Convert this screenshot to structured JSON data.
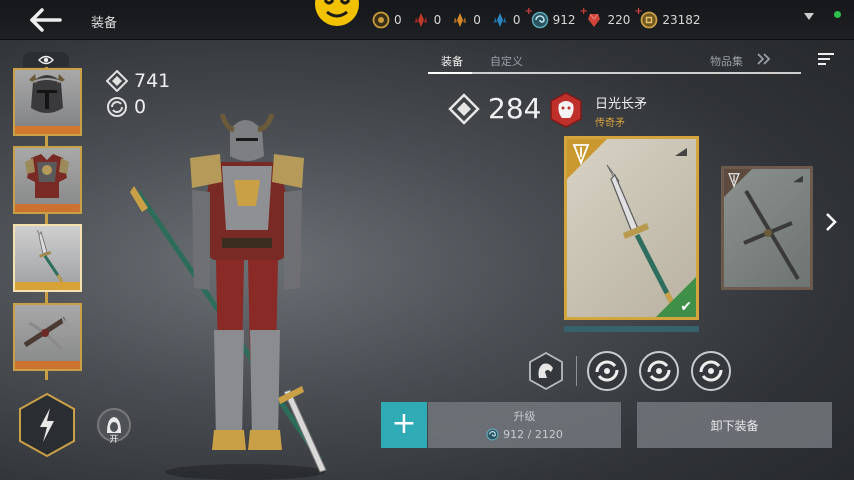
{
  "header": {
    "title": "装备"
  },
  "resources": [
    {
      "name": "gold-orb-icon",
      "value": "0",
      "color": "#c89c3c",
      "has_plus": false
    },
    {
      "name": "red-crystal-icon",
      "value": "0",
      "color": "#c0392b",
      "has_plus": false
    },
    {
      "name": "orange-crystal-icon",
      "value": "0",
      "color": "#d68a2c",
      "has_plus": false
    },
    {
      "name": "blue-crystal-icon",
      "value": "0",
      "color": "#2e86c1",
      "has_plus": false
    },
    {
      "name": "swirl-orb-icon",
      "value": "912",
      "color": "#5fa7b6",
      "has_plus": true
    },
    {
      "name": "ruby-icon",
      "value": "220",
      "color": "#d0453a",
      "has_plus": true
    },
    {
      "name": "coin-icon",
      "value": "23182",
      "color": "#c9a046",
      "has_plus": true
    }
  ],
  "character": {
    "power": "741",
    "secondary": "0",
    "toggle_label": "开"
  },
  "tabs": [
    {
      "label": "装备",
      "active": true
    },
    {
      "label": "自定义",
      "active": false
    },
    {
      "label": "物品集",
      "active": false
    }
  ],
  "item": {
    "power": "284",
    "name": "日光长矛",
    "rarity": "传奇矛",
    "faction_color": "#c0302b",
    "rarity_color": "#d9a23a"
  },
  "actions": {
    "upgrade_label": "升级",
    "upgrade_cost_current": "912",
    "upgrade_cost_separator": "/",
    "upgrade_cost_total": "2120",
    "unequip_label": "卸下装备",
    "plus_label": "+"
  },
  "colors": {
    "accent_gold": "#c9a046",
    "accent_teal": "#2eabb5",
    "equipped_green": "#3f8f49"
  }
}
